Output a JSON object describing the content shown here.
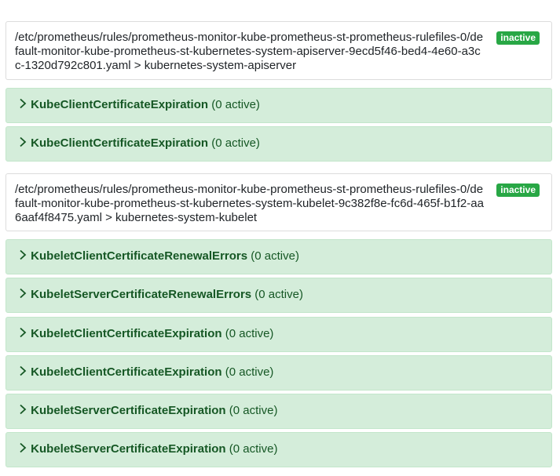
{
  "groups": [
    {
      "path": "/etc/prometheus/rules/prometheus-monitor-kube-prometheus-st-prometheus-rulefiles-0/default-monitor-kube-prometheus-st-kubernetes-system-apiserver-9ecd5f46-bed4-4e60-a3cc-1320d792c801.yaml > kubernetes-system-apiserver",
      "status": "inactive",
      "rules": [
        {
          "name": "KubeClientCertificateExpiration",
          "count": "(0 active)"
        },
        {
          "name": "KubeClientCertificateExpiration",
          "count": "(0 active)"
        }
      ]
    },
    {
      "path": "/etc/prometheus/rules/prometheus-monitor-kube-prometheus-st-prometheus-rulefiles-0/default-monitor-kube-prometheus-st-kubernetes-system-kubelet-9c382f8e-fc6d-465f-b1f2-aa6aaf4f8475.yaml > kubernetes-system-kubelet",
      "status": "inactive",
      "rules": [
        {
          "name": "KubeletClientCertificateRenewalErrors",
          "count": "(0 active)"
        },
        {
          "name": "KubeletServerCertificateRenewalErrors",
          "count": "(0 active)"
        },
        {
          "name": "KubeletClientCertificateExpiration",
          "count": "(0 active)"
        },
        {
          "name": "KubeletClientCertificateExpiration",
          "count": "(0 active)"
        },
        {
          "name": "KubeletServerCertificateExpiration",
          "count": "(0 active)"
        },
        {
          "name": "KubeletServerCertificateExpiration",
          "count": "(0 active)"
        }
      ]
    }
  ],
  "colors": {
    "rule_bg": "#d4edda",
    "rule_text": "#155724",
    "badge_bg": "#28a745"
  },
  "icons": {
    "expand": "chevron-right-icon"
  }
}
